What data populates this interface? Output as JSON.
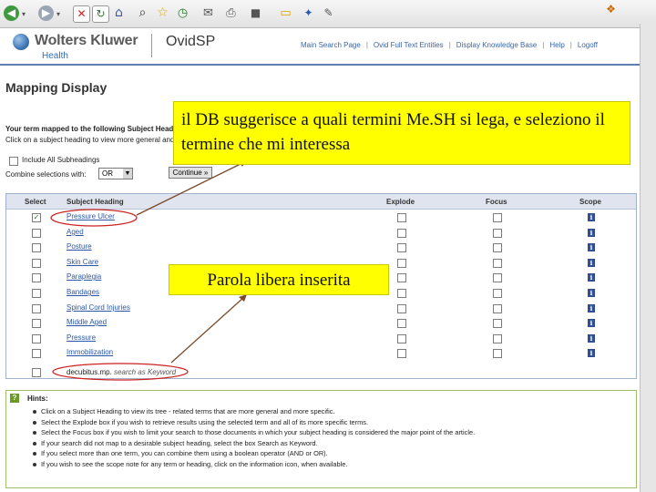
{
  "header": {
    "brand": "Wolters Kluwer",
    "brand_sub": "Health",
    "product": "OvidSP",
    "nav": [
      "Main Search Page",
      "Ovid Full Text Entities",
      "Display Knowledge Base",
      "Help",
      "Logoff"
    ]
  },
  "page": {
    "title": "Mapping Display",
    "instruction_1": "Your term mapped to the following Subject Headings:",
    "instruction_2": "Click on a subject heading to view more general and more specific terms.",
    "include_all_label": "Include All Subheadings",
    "combine_label": "Combine selections with:",
    "combine_value": "OR",
    "continue_label": "Continue »"
  },
  "table": {
    "headers": [
      "Select",
      "Subject Heading",
      "Explode",
      "Focus",
      "Scope"
    ],
    "rows": [
      {
        "term": "Pressure Ulcer",
        "selected": true
      },
      {
        "term": "Aged",
        "selected": false
      },
      {
        "term": "Posture",
        "selected": false
      },
      {
        "term": "Skin Care",
        "selected": false
      },
      {
        "term": "Paraplegia",
        "selected": false
      },
      {
        "term": "Bandages",
        "selected": false
      },
      {
        "term": "Spinal Cord Injuries",
        "selected": false
      },
      {
        "term": "Middle Aged",
        "selected": false
      },
      {
        "term": "Pressure",
        "selected": false
      },
      {
        "term": "Immobilization",
        "selected": false
      }
    ],
    "keyword_row": {
      "term": "decubitus.mp.",
      "suffix": "search as Keyword"
    }
  },
  "hints": {
    "title": "Hints:",
    "items": [
      "Click on a Subject Heading to view its tree - related terms that are more general and more specific.",
      "Select the Explode box if you wish to retrieve results using the selected term and all of its more specific terms.",
      "Select the Focus box if you wish to limit your search to those documents in which your subject heading is considered the major point of the article.",
      "If your search did not map to a desirable subject heading, select the box Search as Keyword.",
      "If you select more than one term, you can combine them using a boolean operator (AND or OR).",
      "If you wish to see the scope note for any term or heading, click on the information icon, when available."
    ]
  },
  "annotations": {
    "callout_1": "il DB suggerisce a quali termini Me.SH si lega, e seleziono il  termine che mi interessa",
    "callout_2": "Parola libera inserita",
    "color": "#ffff00",
    "circle_color": "#cc2222"
  }
}
